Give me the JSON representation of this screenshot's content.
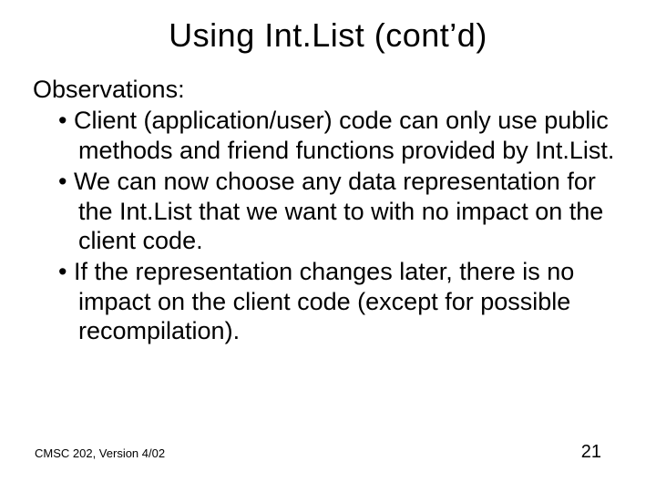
{
  "slide": {
    "title": "Using Int.List (cont’d)",
    "observations_label": "Observations:",
    "bullets": [
      "Client (application/user) code can only use public methods and friend functions provided by Int.List.",
      "We can now choose any data representation for the Int.List that we want to with no impact on the client code.",
      "If the representation changes later, there is no impact on the client code (except for possible recompilation)."
    ],
    "footer_left": "CMSC 202, Version 4/02",
    "page_number": "21"
  }
}
